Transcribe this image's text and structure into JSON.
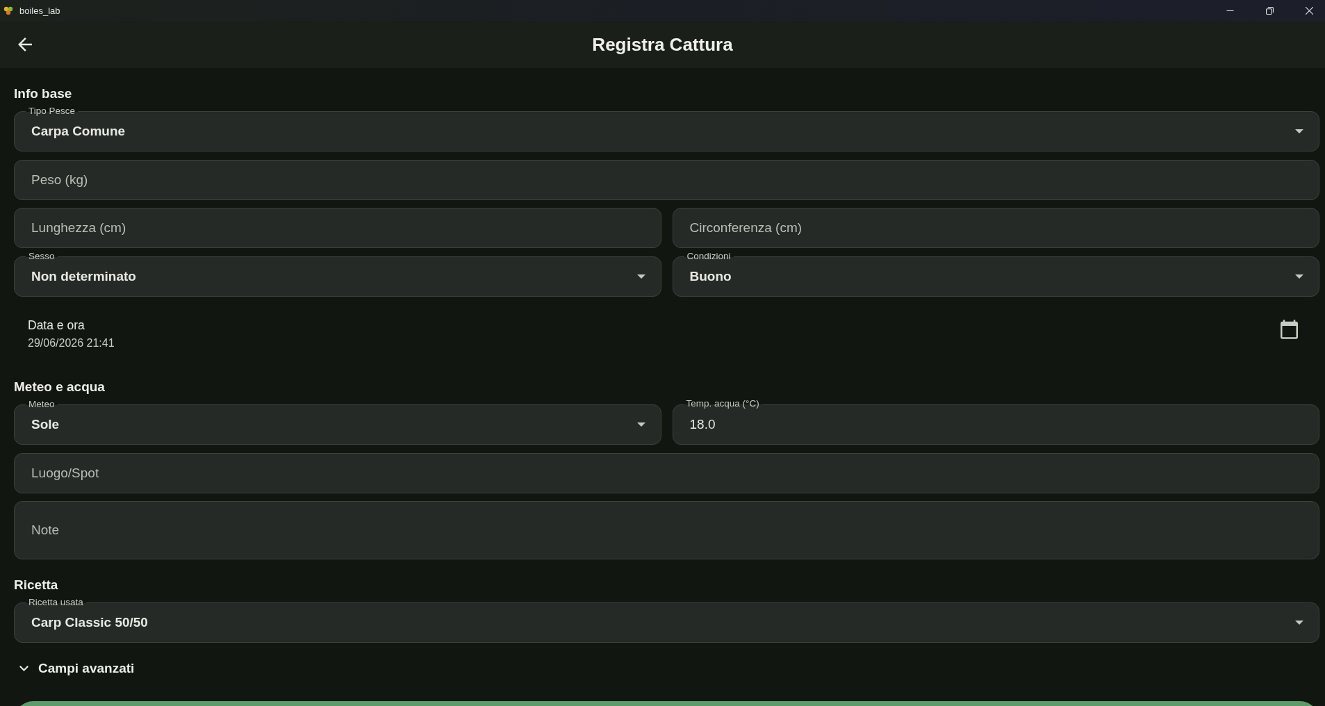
{
  "window": {
    "title": "boiles_lab"
  },
  "app_bar": {
    "title": "Registra Cattura"
  },
  "sections": [
    {
      "title": "Info base",
      "rows": [
        [
          {
            "kind": "dropdown",
            "label": "Tipo Pesce",
            "value": "Carpa Comune"
          }
        ],
        [
          {
            "kind": "text",
            "placeholder": "Peso (kg)"
          }
        ],
        [
          {
            "kind": "text",
            "placeholder": "Lunghezza (cm)"
          },
          {
            "kind": "text",
            "placeholder": "Circonferenza (cm)"
          }
        ],
        [
          {
            "kind": "dropdown",
            "label": "Sesso",
            "value": "Non determinato"
          },
          {
            "kind": "dropdown",
            "label": "Condizioni",
            "value": "Buono"
          }
        ],
        [
          {
            "kind": "datetime",
            "label": "Data e ora",
            "value": "29/06/2026 21:41"
          }
        ]
      ]
    },
    {
      "title": "Meteo e acqua",
      "rows": [
        [
          {
            "kind": "dropdown",
            "label": "Meteo",
            "value": "Sole"
          },
          {
            "kind": "text",
            "label": "Temp. acqua (°C)",
            "value": "18.0"
          }
        ],
        [
          {
            "kind": "text",
            "placeholder": "Luogo/Spot"
          }
        ],
        [
          {
            "kind": "multiline",
            "placeholder": "Note"
          }
        ]
      ]
    },
    {
      "title": "Ricetta",
      "rows": [
        [
          {
            "kind": "dropdown",
            "label": "Ricetta usata",
            "value": "Carp Classic 50/50"
          }
        ]
      ]
    }
  ],
  "advanced": {
    "label": "Campi avanzati",
    "expanded": false
  }
}
